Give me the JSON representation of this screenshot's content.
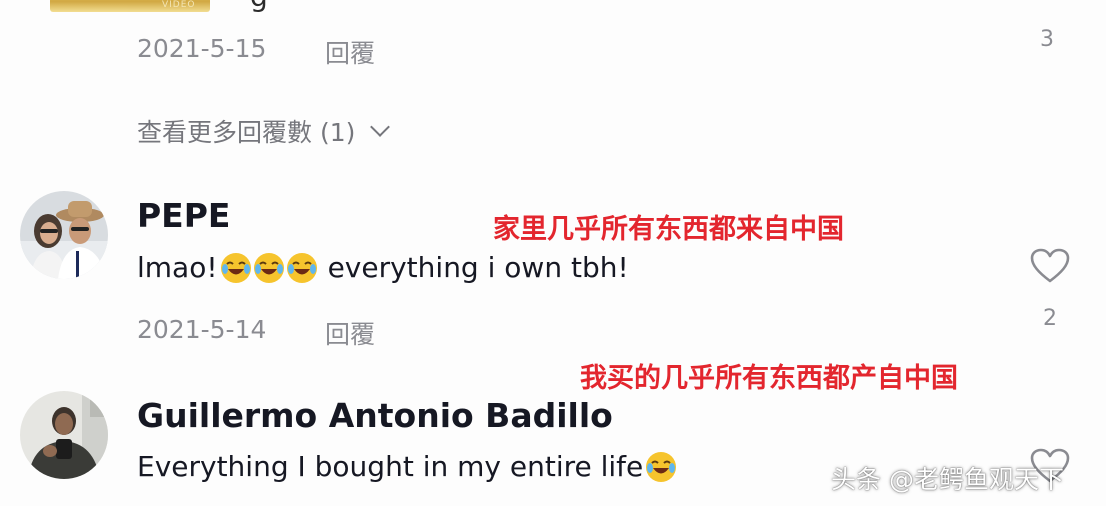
{
  "top_comment": {
    "logo_text": "VIDEO",
    "partial_text": "g",
    "date": "2021-5-15",
    "reply_label": "回覆",
    "like_count": "3"
  },
  "view_more": {
    "label": "查看更多回覆數 (1)"
  },
  "comments": [
    {
      "username": "PEPE",
      "text_before": "lmao!",
      "text_after": "everything i own tbh!",
      "emoji": "face-with-tears-of-joy",
      "date": "2021-5-14",
      "reply_label": "回覆",
      "like_count": "2",
      "annotation": "家里几乎所有东西都来自中国"
    },
    {
      "username": "Guillermo Antonio Badillo",
      "text_before": "Everything I bought in my entire life",
      "emoji": "face-with-tears-of-joy",
      "annotation": "我买的几乎所有东西都产自中国"
    }
  ],
  "watermark": "头条 @老鳄鱼观天下",
  "colors": {
    "annotation": "#e3262e",
    "meta": "#8a8b91",
    "text": "#161823"
  },
  "icons": [
    "heart-icon",
    "chevron-down-icon",
    "laughing-emoji-icon"
  ]
}
